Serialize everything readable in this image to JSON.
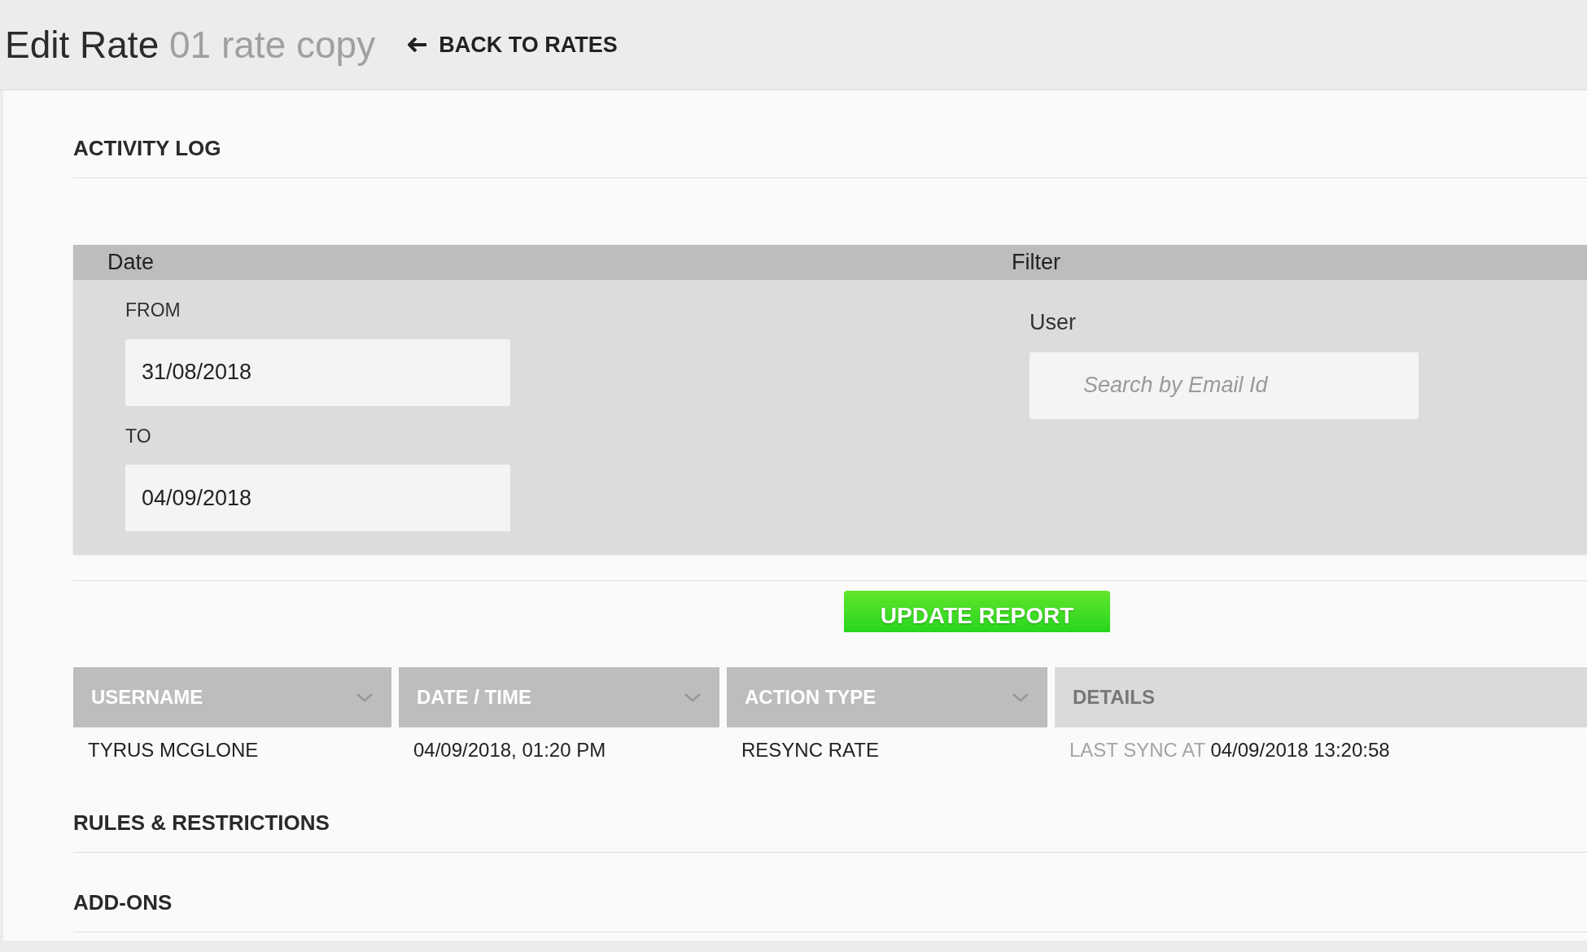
{
  "header": {
    "title": "Edit Rate",
    "subtitle": "01 rate copy",
    "back_link": "BACK TO RATES"
  },
  "activity_log": {
    "title": "ACTIVITY LOG",
    "filters": {
      "date_heading": "Date",
      "filter_heading": "Filter",
      "from_label": "FROM",
      "from_value": "31/08/2018",
      "to_label": "TO",
      "to_value": "04/09/2018",
      "user_label": "User",
      "user_placeholder": "Search by Email Id"
    },
    "update_button": "UPDATE REPORT",
    "table": {
      "columns": [
        {
          "label": "USERNAME",
          "sortable": true
        },
        {
          "label": "DATE / TIME",
          "sortable": true
        },
        {
          "label": "ACTION TYPE",
          "sortable": true
        },
        {
          "label": "DETAILS",
          "sortable": false
        }
      ],
      "rows": [
        {
          "cells": [
            "TYRUS MCGLONE",
            "04/09/2018, 01:20 PM",
            "RESYNC RATE"
          ],
          "details_label": "LAST SYNC AT",
          "details_value": "04/09/2018 13:20:58"
        }
      ]
    }
  },
  "collapsed_sections": [
    {
      "title": "RULES & RESTRICTIONS"
    },
    {
      "title": "ADD-ONS"
    }
  ]
}
